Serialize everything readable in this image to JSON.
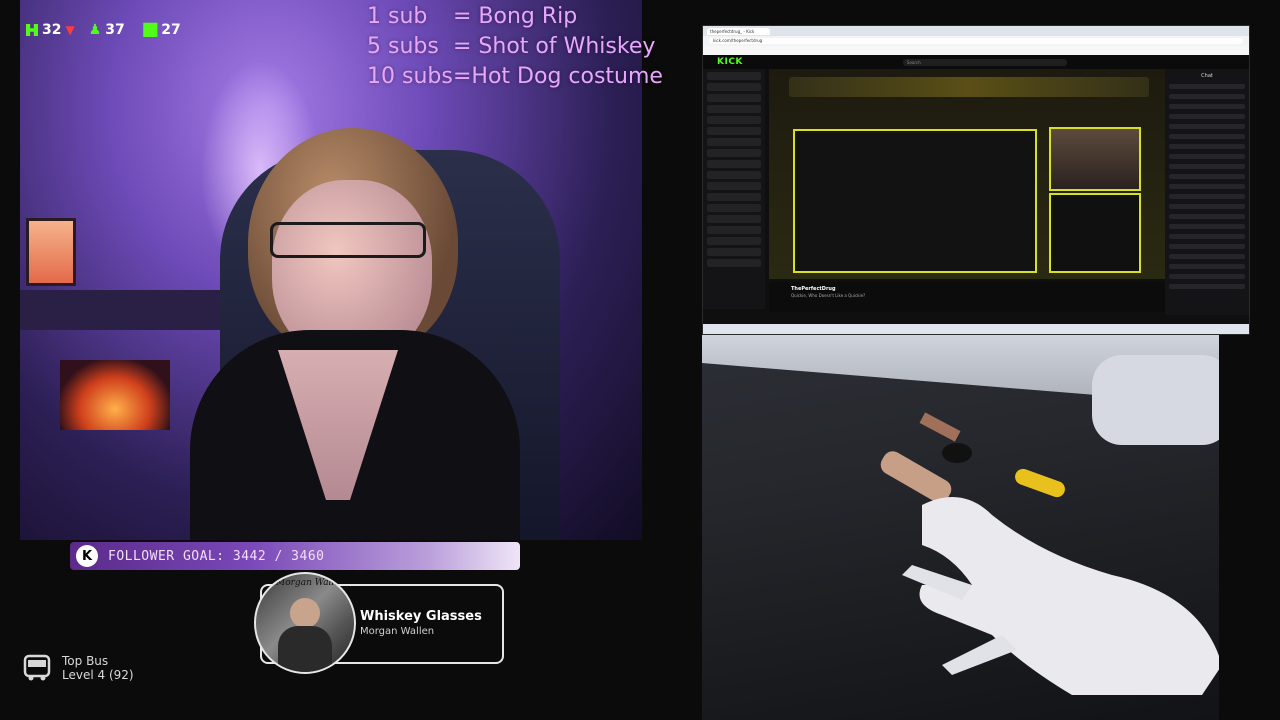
{
  "stream_stats": {
    "stat_a": "32",
    "stat_b": "37",
    "stat_c": "27"
  },
  "sub_goals": [
    {
      "left": "1 sub",
      "right": "= Bong Rip"
    },
    {
      "left": "5 subs",
      "right": "= Shot of Whiskey"
    },
    {
      "left": "10 subs",
      "right": "=Hot Dog costume"
    }
  ],
  "follower_goal": {
    "label": "FOLLOWER GOAL: 3442 / 3460",
    "current": 3442,
    "target": 3460
  },
  "now_playing": {
    "song": "Whiskey Glasses",
    "artist": "Morgan Wallen",
    "art_text": "Morgan Wallen"
  },
  "top_bus": {
    "title": "Top Bus",
    "level": "Level 4  (92)"
  },
  "browser": {
    "tab": "theperfectdrug_ - Kick",
    "url": "kick.com/theperfectdrug",
    "brand": "KICK",
    "search_placeholder": "Search",
    "channel_name": "ThePerfectDrug",
    "stream_title": "Quickie, Who Doesn't Like a Quickie?",
    "chat_title": "Chat"
  },
  "colors": {
    "kick_green": "#53fc18",
    "sub_goal_pink": "#e8a6ff",
    "stat_down_red": "#ff3b3b"
  },
  "icons": {
    "kick": "kick-logo-icon",
    "down": "arrow-down-icon",
    "viewers": "person-icon",
    "signal": "bars-icon",
    "bus": "bus-icon"
  }
}
